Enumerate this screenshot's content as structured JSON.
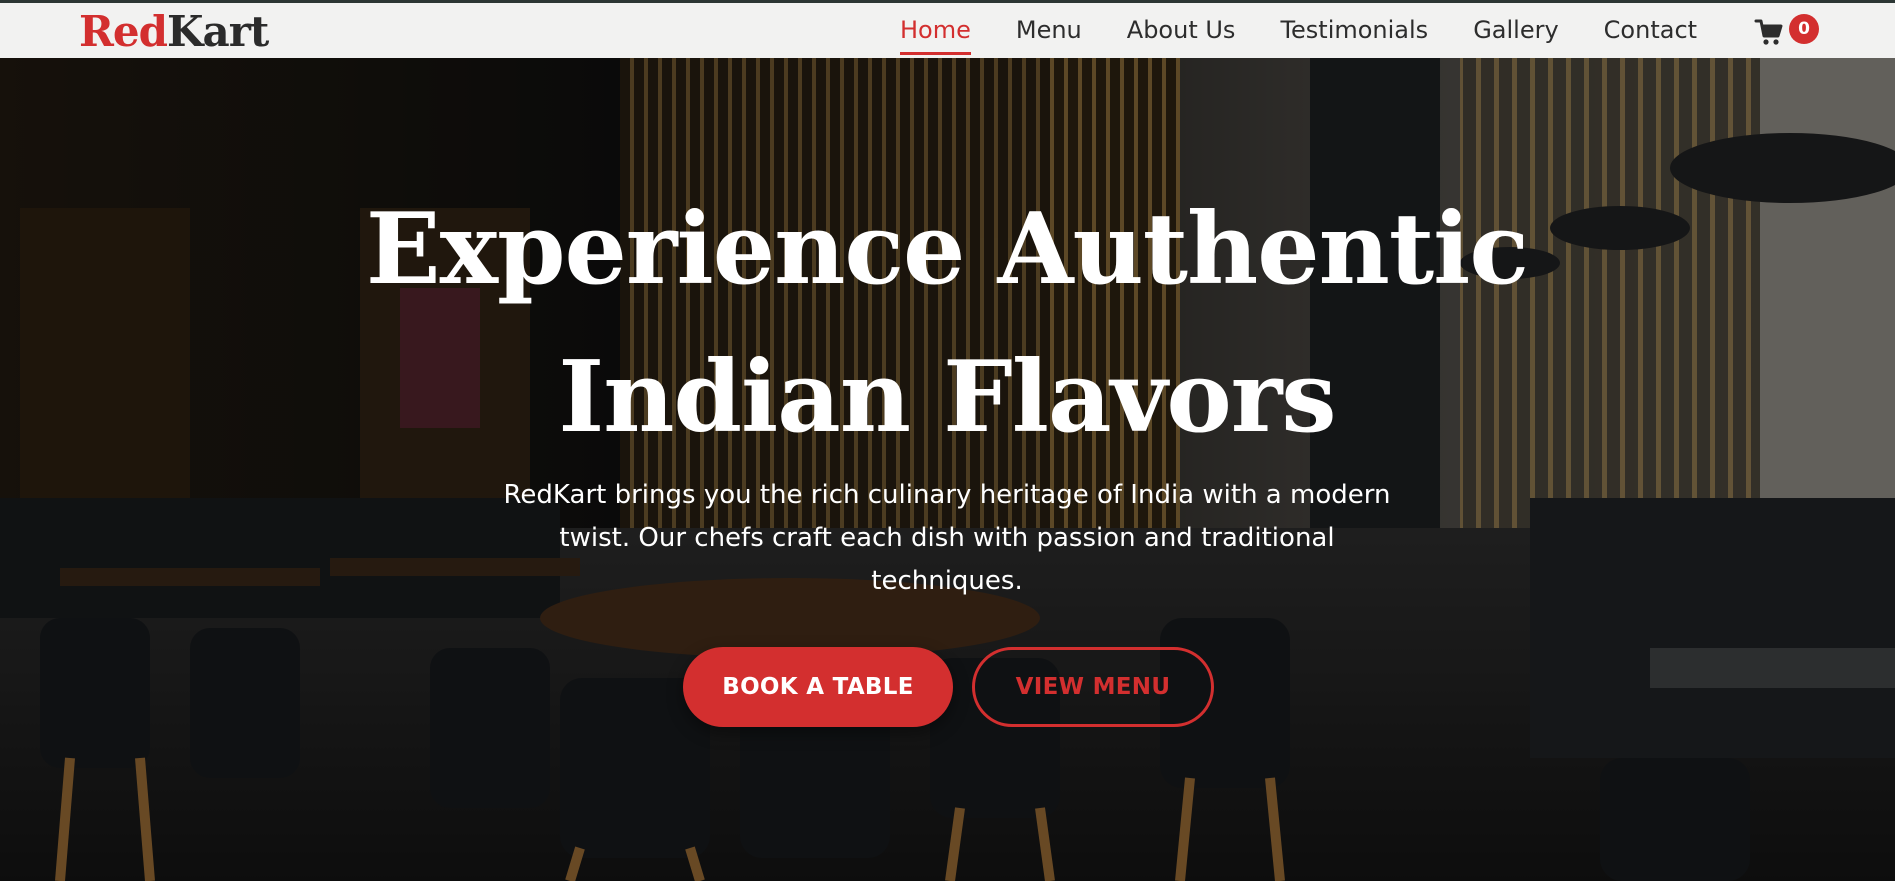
{
  "brand": {
    "logo_part1": "Red",
    "logo_part2": "Kart",
    "primary_color": "#d32f2f",
    "dark_color": "#2b2b2b"
  },
  "nav": {
    "items": [
      {
        "label": "Home",
        "active": true
      },
      {
        "label": "Menu",
        "active": false
      },
      {
        "label": "About Us",
        "active": false
      },
      {
        "label": "Testimonials",
        "active": false
      },
      {
        "label": "Gallery",
        "active": false
      },
      {
        "label": "Contact",
        "active": false
      }
    ],
    "cart_icon": "shopping-cart-icon",
    "cart_count": "0"
  },
  "hero": {
    "title_line1": "Experience Authentic",
    "title_line2": "Indian Flavors",
    "subtitle": "RedKart brings you the rich culinary heritage of India with a modern twist. Our chefs craft each dish with passion and traditional techniques.",
    "primary_button": "BOOK A TABLE",
    "secondary_button": "VIEW MENU",
    "background": "restaurant-interior-photo"
  }
}
